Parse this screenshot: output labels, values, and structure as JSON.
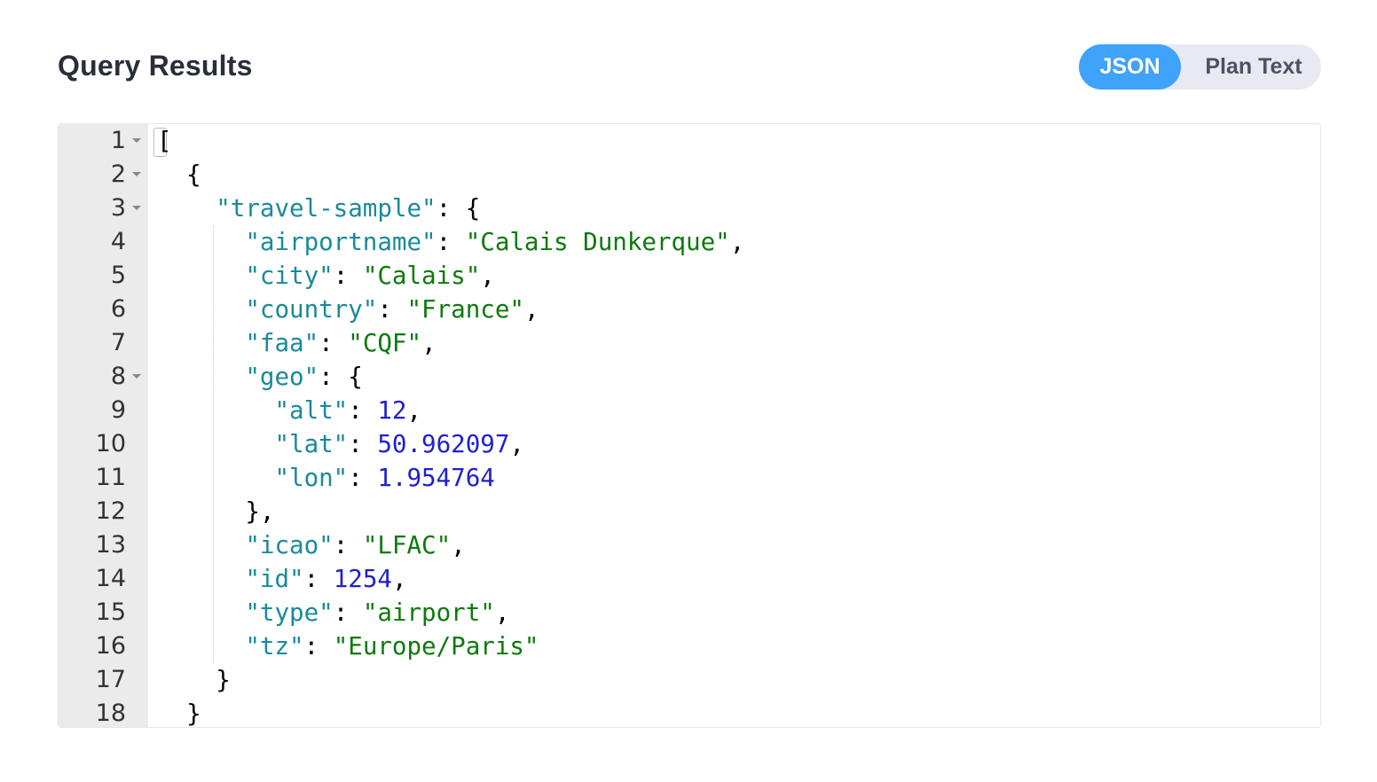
{
  "header": {
    "title": "Query Results"
  },
  "view_toggle": {
    "options": [
      {
        "label": "JSON",
        "active": true
      },
      {
        "label": "Plan Text",
        "active": false
      }
    ],
    "active_color": "#3fa2fb"
  },
  "editor": {
    "lines": [
      {
        "n": "1",
        "fold": true,
        "indent": 0,
        "tokens": [
          {
            "t": "p",
            "v": "["
          }
        ]
      },
      {
        "n": "2",
        "fold": true,
        "indent": 1,
        "tokens": [
          {
            "t": "p",
            "v": "{"
          }
        ]
      },
      {
        "n": "3",
        "fold": true,
        "indent": 2,
        "tokens": [
          {
            "t": "k",
            "v": "\"travel-sample\""
          },
          {
            "t": "p",
            "v": ": {"
          }
        ]
      },
      {
        "n": "4",
        "fold": false,
        "indent": 3,
        "tokens": [
          {
            "t": "k",
            "v": "\"airportname\""
          },
          {
            "t": "p",
            "v": ": "
          },
          {
            "t": "s",
            "v": "\"Calais Dunkerque\""
          },
          {
            "t": "p",
            "v": ","
          }
        ]
      },
      {
        "n": "5",
        "fold": false,
        "indent": 3,
        "tokens": [
          {
            "t": "k",
            "v": "\"city\""
          },
          {
            "t": "p",
            "v": ": "
          },
          {
            "t": "s",
            "v": "\"Calais\""
          },
          {
            "t": "p",
            "v": ","
          }
        ]
      },
      {
        "n": "6",
        "fold": false,
        "indent": 3,
        "tokens": [
          {
            "t": "k",
            "v": "\"country\""
          },
          {
            "t": "p",
            "v": ": "
          },
          {
            "t": "s",
            "v": "\"France\""
          },
          {
            "t": "p",
            "v": ","
          }
        ]
      },
      {
        "n": "7",
        "fold": false,
        "indent": 3,
        "tokens": [
          {
            "t": "k",
            "v": "\"faa\""
          },
          {
            "t": "p",
            "v": ": "
          },
          {
            "t": "s",
            "v": "\"CQF\""
          },
          {
            "t": "p",
            "v": ","
          }
        ]
      },
      {
        "n": "8",
        "fold": true,
        "indent": 3,
        "tokens": [
          {
            "t": "k",
            "v": "\"geo\""
          },
          {
            "t": "p",
            "v": ": {"
          }
        ]
      },
      {
        "n": "9",
        "fold": false,
        "indent": 4,
        "tokens": [
          {
            "t": "k",
            "v": "\"alt\""
          },
          {
            "t": "p",
            "v": ": "
          },
          {
            "t": "n",
            "v": "12"
          },
          {
            "t": "p",
            "v": ","
          }
        ]
      },
      {
        "n": "10",
        "fold": false,
        "indent": 4,
        "tokens": [
          {
            "t": "k",
            "v": "\"lat\""
          },
          {
            "t": "p",
            "v": ": "
          },
          {
            "t": "n",
            "v": "50.962097"
          },
          {
            "t": "p",
            "v": ","
          }
        ]
      },
      {
        "n": "11",
        "fold": false,
        "indent": 4,
        "tokens": [
          {
            "t": "k",
            "v": "\"lon\""
          },
          {
            "t": "p",
            "v": ": "
          },
          {
            "t": "n",
            "v": "1.954764"
          }
        ]
      },
      {
        "n": "12",
        "fold": false,
        "indent": 3,
        "tokens": [
          {
            "t": "p",
            "v": "},"
          }
        ]
      },
      {
        "n": "13",
        "fold": false,
        "indent": 3,
        "tokens": [
          {
            "t": "k",
            "v": "\"icao\""
          },
          {
            "t": "p",
            "v": ": "
          },
          {
            "t": "s",
            "v": "\"LFAC\""
          },
          {
            "t": "p",
            "v": ","
          }
        ]
      },
      {
        "n": "14",
        "fold": false,
        "indent": 3,
        "tokens": [
          {
            "t": "k",
            "v": "\"id\""
          },
          {
            "t": "p",
            "v": ": "
          },
          {
            "t": "n",
            "v": "1254"
          },
          {
            "t": "p",
            "v": ","
          }
        ]
      },
      {
        "n": "15",
        "fold": false,
        "indent": 3,
        "tokens": [
          {
            "t": "k",
            "v": "\"type\""
          },
          {
            "t": "p",
            "v": ": "
          },
          {
            "t": "s",
            "v": "\"airport\""
          },
          {
            "t": "p",
            "v": ","
          }
        ]
      },
      {
        "n": "16",
        "fold": false,
        "indent": 3,
        "tokens": [
          {
            "t": "k",
            "v": "\"tz\""
          },
          {
            "t": "p",
            "v": ": "
          },
          {
            "t": "s",
            "v": "\"Europe/Paris\""
          }
        ]
      },
      {
        "n": "17",
        "fold": false,
        "indent": 2,
        "tokens": [
          {
            "t": "p",
            "v": "}"
          }
        ]
      },
      {
        "n": "18",
        "fold": false,
        "indent": 1,
        "tokens": [
          {
            "t": "p",
            "v": "}"
          }
        ]
      }
    ],
    "colors": {
      "key": "#1a8a9a",
      "string": "#0c7a0c",
      "number": "#1f1fcf"
    }
  }
}
